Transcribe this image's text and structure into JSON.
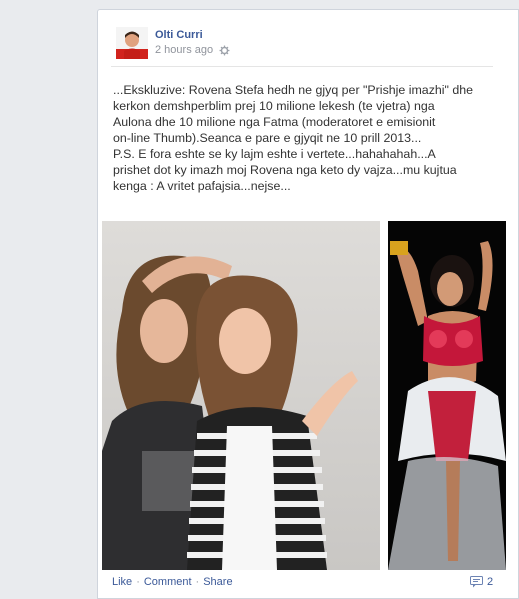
{
  "post": {
    "author": "Olti Curri",
    "timestamp": "2 hours ago",
    "privacy_icon": "gear-icon",
    "text_lines": [
      "...Ekskluzive: Rovena Stefa hedh ne gjyq per \"Prishje imazhi\" dhe",
      "kerkon demshperblim prej 10 milione lekesh (te vjetra) nga",
      "Aulona dhe 10 milione nga Fatma (moderatoret e emisionit",
      "on-line Thumb).Seanca e pare e gjyqit ne 10 prill 2013...",
      "P.S. E fora eshte se ky lajm eshte i vertete...hahahahah...A",
      "prishet dot ky imazh moj Rovena nga keto dy vajza...mu kujtua",
      "kenga : A vritet pafajsia...nejse..."
    ]
  },
  "actions": {
    "like": "Like",
    "comment": "Comment",
    "share": "Share",
    "separator": "·",
    "comment_count": "2"
  },
  "colors": {
    "link": "#3b5998",
    "text": "#333333",
    "muted": "#90949c"
  }
}
